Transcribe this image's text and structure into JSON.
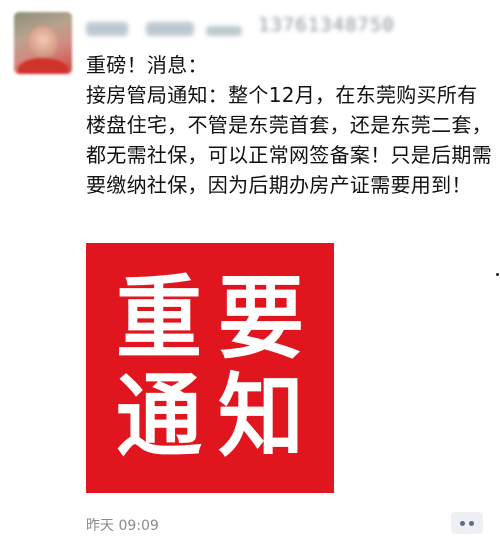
{
  "post": {
    "author_name_redacted": "██████",
    "author_phone_redacted": "13761348750",
    "text_line1": "重磅！消息：",
    "text_body": "接房管局通知：整个12月，在东莞购买所有楼盘住宅，不管是东莞首套，还是东莞二套，都无需社保，可以正常网签备案！只是后期需要缴纳社保，因为后期办房产证需要用到！",
    "image": {
      "row1": [
        "重",
        "要"
      ],
      "row2": [
        "通",
        "知"
      ],
      "background_color": "#e0151d",
      "text_color": "#ffffff"
    },
    "timestamp": "昨天 09:09"
  },
  "icons": {
    "more": "more-dots-icon",
    "avatar": "avatar-image"
  },
  "colors": {
    "timestamp": "#8a8a8a",
    "more_button_bg": "#eef0f3",
    "more_button_dots": "#5b6b8c"
  }
}
